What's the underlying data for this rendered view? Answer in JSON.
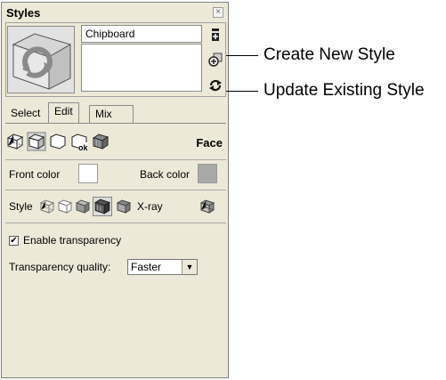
{
  "window": {
    "title": "Styles",
    "close_glyph": "×"
  },
  "style_details": {
    "name_value": "Chipboard",
    "description_value": ""
  },
  "tabs": [
    {
      "label": "Select",
      "active": false
    },
    {
      "label": "Edit",
      "active": true
    },
    {
      "label": "Mix",
      "active": false
    }
  ],
  "edit": {
    "section_label": "Face",
    "icons": [
      "edge-settings-icon",
      "face-settings-icon",
      "background-settings-icon",
      "watermark-settings-icon",
      "modeling-settings-icon"
    ],
    "front_color_label": "Front color",
    "back_color_label": "Back color",
    "front_color": "#ffffff",
    "back_color": "#a8a8a8",
    "style_label": "Style",
    "xray_label": "X-ray",
    "enable_transparency_label": "Enable transparency",
    "enable_transparency_checked": "✔",
    "transparency_quality_label": "Transparency quality:",
    "transparency_quality_value": "Faster"
  },
  "callouts": {
    "create_new_style": "Create New Style",
    "update_existing_style": "Update Existing Style"
  }
}
